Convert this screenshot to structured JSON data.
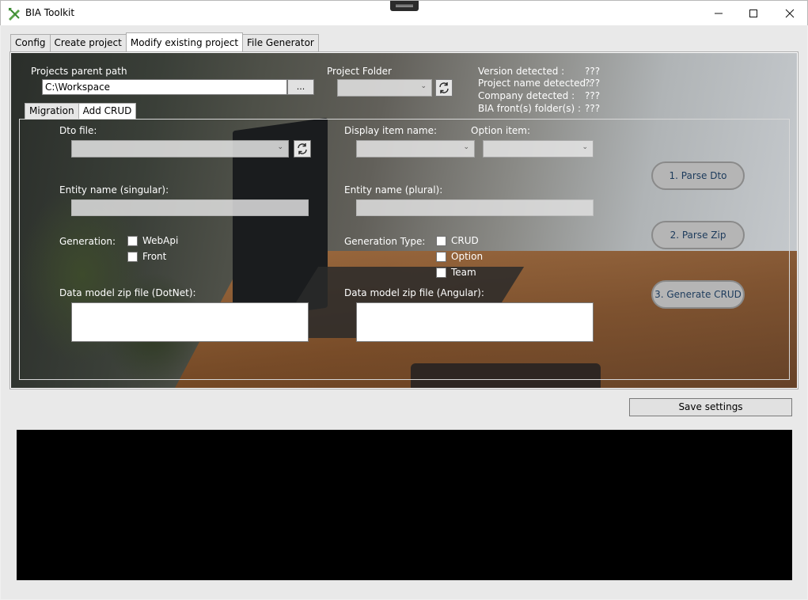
{
  "window": {
    "title": "BIA Toolkit",
    "minimize_glyph": "—",
    "maximize_glyph": "☐",
    "close_glyph": "✕"
  },
  "tabs": [
    {
      "label": "Config",
      "active": false
    },
    {
      "label": "Create project",
      "active": false
    },
    {
      "label": "Modify existing project",
      "active": true
    },
    {
      "label": "File Generator",
      "active": false
    }
  ],
  "project": {
    "parent_path_label": "Projects parent path",
    "parent_path_value": "C:\\Workspace",
    "browse_label": "...",
    "folder_label": "Project Folder"
  },
  "detected": {
    "version_label": "Version detected :",
    "version_value": "???",
    "project_name_label": "Project name detected :",
    "project_name_value": "???",
    "company_label": "Company detected :",
    "company_value": "???",
    "front_label": "BIA front(s) folder(s) :",
    "front_value": "???"
  },
  "sub_tabs": [
    {
      "label": "Migration",
      "active": false
    },
    {
      "label": "Add CRUD",
      "active": true
    }
  ],
  "crud": {
    "dto_file_label": "Dto file:",
    "display_item_label": "Display item name:",
    "option_item_label": "Option item:",
    "entity_singular_label": "Entity name (singular):",
    "entity_plural_label": "Entity name (plural):",
    "generation_label": "Generation:",
    "generation_options": [
      "WebApi",
      "Front"
    ],
    "generation_type_label": "Generation Type:",
    "generation_type_options": [
      "CRUD",
      "Option",
      "Team"
    ],
    "zip_dotnet_label": "Data model zip file (DotNet):",
    "zip_angular_label": "Data model zip file (Angular):",
    "parse_dto_button": "1. Parse Dto",
    "parse_zip_button": "2. Parse Zip",
    "generate_crud_button": "3. Generate CRUD"
  },
  "save_settings_button": "Save settings",
  "icons": {
    "app": "pencil-ruler-icon",
    "refresh": "refresh-icon",
    "chevron": "chevron-down-icon"
  }
}
